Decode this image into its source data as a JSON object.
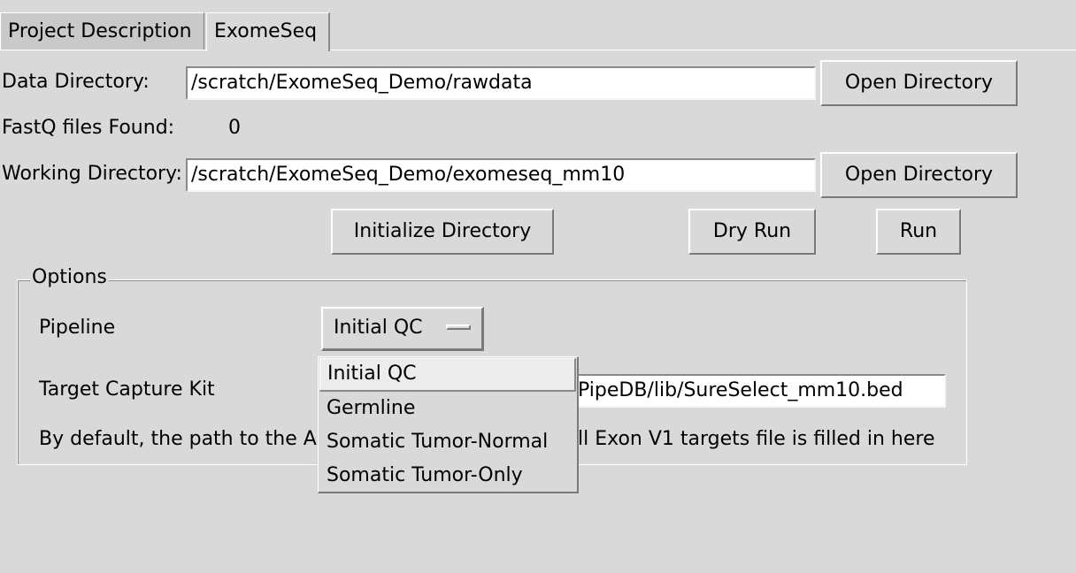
{
  "tabs": [
    {
      "label": "Project Description"
    },
    {
      "label": "ExomeSeq"
    }
  ],
  "data_directory": {
    "label": "Data Directory:",
    "value": "/scratch/ExomeSeq_Demo/rawdata",
    "button": "Open Directory"
  },
  "fastq": {
    "label": "FastQ files Found:",
    "count": "0"
  },
  "working_directory": {
    "label": "Working Directory:",
    "value": "/scratch/ExomeSeq_Demo/exomeseq_mm10",
    "button": "Open Directory"
  },
  "actions": {
    "initialize": "Initialize Directory",
    "dry_run": "Dry Run",
    "run": "Run"
  },
  "options": {
    "legend": "Options",
    "pipeline_label": "Pipeline",
    "pipeline_selected": "Initial QC",
    "target_label": "Target Capture Kit",
    "target_value_visible": "PipeDB/lib/SureSelect_mm10.bed",
    "note_left": "By default, the path to the A",
    "note_right": "ll Exon V1 targets file is filled in here"
  },
  "pipeline_menu": {
    "items": [
      {
        "label": "Initial QC"
      },
      {
        "label": "Germline"
      },
      {
        "label": "Somatic Tumor-Normal"
      },
      {
        "label": "Somatic Tumor-Only"
      }
    ]
  },
  "colors": {
    "background": "#d9d9d9",
    "entry": "#ffffff",
    "highlight": "#ececec"
  }
}
